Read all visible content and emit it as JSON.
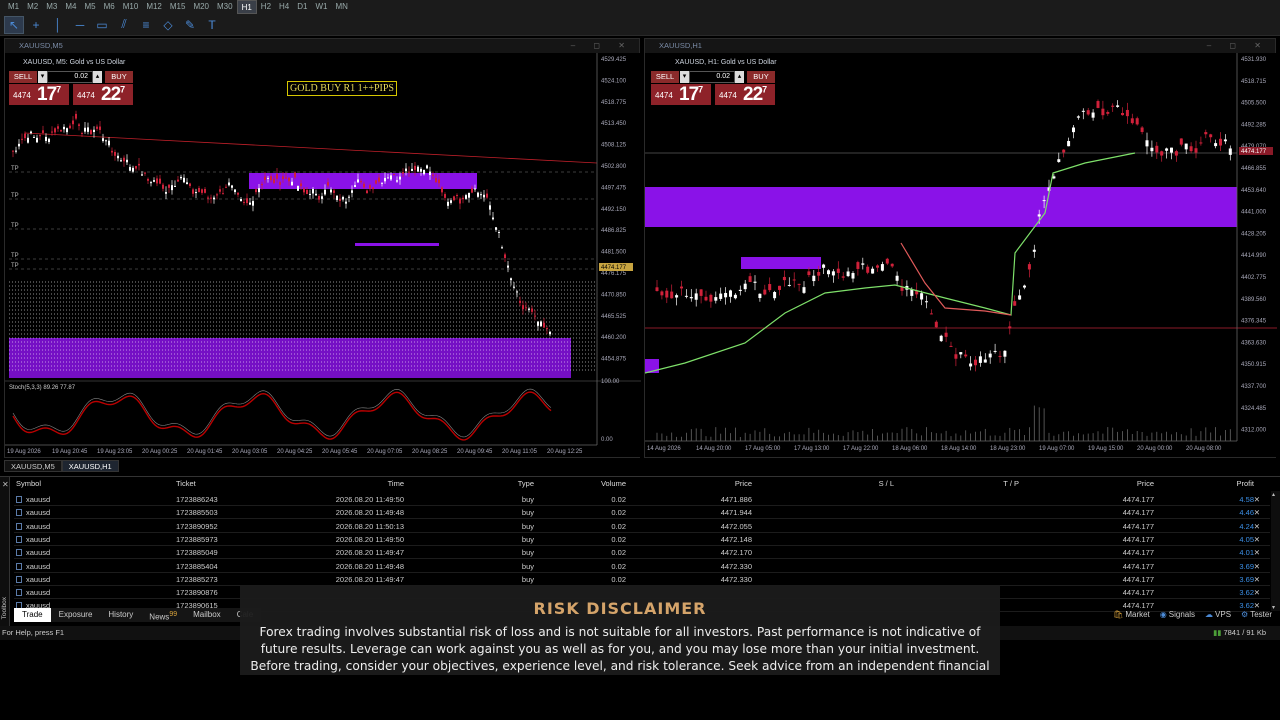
{
  "timeframes": [
    "M1",
    "M2",
    "M3",
    "M4",
    "M5",
    "M6",
    "M10",
    "M12",
    "M15",
    "M20",
    "M30",
    "H1",
    "H2",
    "H4",
    "D1",
    "W1",
    "MN"
  ],
  "active_timeframe": "H1",
  "toolbar_icons": [
    "cursor-icon",
    "crosshair-icon",
    "vertical-line-icon",
    "horizontal-line-icon",
    "rectangle-icon",
    "channel-icon",
    "fibonacci-icon",
    "shapes-icon",
    "pencil-icon",
    "text-icon"
  ],
  "left_window": {
    "title": "XAUUSD,M5",
    "symbol_label": "XAUUSD, M5:  Gold vs US Dollar",
    "sell_label": "SELL",
    "buy_label": "BUY",
    "volume": "0.02",
    "bid_small": "4474",
    "bid_big": "17",
    "bid_sup": "7",
    "ask_small": "4474",
    "ask_big": "22",
    "ask_sup": "7",
    "annotation": "GOLD BUY R1 1++PIPS",
    "indicator_label": "Stoch(5,3,3) 89.26 77.87",
    "y_ticks": [
      "4529.425",
      "4524.100",
      "4518.775",
      "4513.450",
      "4508.125",
      "4502.800",
      "4497.475",
      "4492.150",
      "4486.825",
      "4481.500",
      "4476.175",
      "4470.850",
      "4465.525",
      "4460.200",
      "4454.875",
      "100.00",
      "0.00"
    ],
    "highlight_tick": "4474.177",
    "x_ticks": [
      "19 Aug 2026",
      "19 Aug 20:45",
      "19 Aug 23:05",
      "20 Aug 00:25",
      "20 Aug 01:45",
      "20 Aug 03:05",
      "20 Aug 04:25",
      "20 Aug 05:45",
      "20 Aug 07:05",
      "20 Aug 08:25",
      "20 Aug 09:45",
      "20 Aug 11:05",
      "20 Aug 12:25"
    ],
    "tp_labels": [
      "TP",
      "TP",
      "TP",
      "TP",
      "TP"
    ]
  },
  "right_window": {
    "title": "XAUUSD,H1",
    "symbol_label": "XAUUSD, H1:  Gold vs US Dollar",
    "sell_label": "SELL",
    "buy_label": "BUY",
    "volume": "0.02",
    "bid_small": "4474",
    "bid_big": "17",
    "bid_sup": "7",
    "ask_small": "4474",
    "ask_big": "22",
    "ask_sup": "7",
    "y_ticks": [
      "4531.930",
      "4518.715",
      "4505.500",
      "4492.285",
      "4479.070",
      "4466.855",
      "4453.640",
      "4441.000",
      "4428.205",
      "4414.990",
      "4402.775",
      "4389.560",
      "4376.345",
      "4363.630",
      "4350.915",
      "4337.700",
      "4324.485",
      "4312.000"
    ],
    "highlight_tick": "4474.177",
    "x_ticks": [
      "14 Aug 2026",
      "14 Aug 20:00",
      "17 Aug 05:00",
      "17 Aug 13:00",
      "17 Aug 22:00",
      "18 Aug 06:00",
      "18 Aug 14:00",
      "18 Aug 23:00",
      "19 Aug 07:00",
      "19 Aug 15:00",
      "20 Aug 00:00",
      "20 Aug 08:00"
    ]
  },
  "chart_tabs": [
    "XAUUSD,M5",
    "XAUUSD,H1"
  ],
  "active_chart_tab": "XAUUSD,H1",
  "terminal": {
    "columns": [
      "Symbol",
      "Ticket",
      "Time",
      "Type",
      "Volume",
      "Price",
      "S / L",
      "T / P",
      "Price",
      "Profit"
    ],
    "rows": [
      {
        "symbol": "xauusd",
        "ticket": "1723886243",
        "time": "2026.08.20 11:49:50",
        "type": "buy",
        "volume": "0.02",
        "price": "4471.886",
        "sl": "",
        "tp": "",
        "cur": "4474.177",
        "profit": "4.58"
      },
      {
        "symbol": "xauusd",
        "ticket": "1723885503",
        "time": "2026.08.20 11:49:48",
        "type": "buy",
        "volume": "0.02",
        "price": "4471.944",
        "sl": "",
        "tp": "",
        "cur": "4474.177",
        "profit": "4.46"
      },
      {
        "symbol": "xauusd",
        "ticket": "1723890952",
        "time": "2026.08.20 11:50:13",
        "type": "buy",
        "volume": "0.02",
        "price": "4472.055",
        "sl": "",
        "tp": "",
        "cur": "4474.177",
        "profit": "4.24"
      },
      {
        "symbol": "xauusd",
        "ticket": "1723885973",
        "time": "2026.08.20 11:49:50",
        "type": "buy",
        "volume": "0.02",
        "price": "4472.148",
        "sl": "",
        "tp": "",
        "cur": "4474.177",
        "profit": "4.05"
      },
      {
        "symbol": "xauusd",
        "ticket": "1723885049",
        "time": "2026.08.20 11:49:47",
        "type": "buy",
        "volume": "0.02",
        "price": "4472.170",
        "sl": "",
        "tp": "",
        "cur": "4474.177",
        "profit": "4.01"
      },
      {
        "symbol": "xauusd",
        "ticket": "1723885404",
        "time": "2026.08.20 11:49:48",
        "type": "buy",
        "volume": "0.02",
        "price": "4472.330",
        "sl": "",
        "tp": "",
        "cur": "4474.177",
        "profit": "3.69"
      },
      {
        "symbol": "xauusd",
        "ticket": "1723885273",
        "time": "2026.08.20 11:49:47",
        "type": "buy",
        "volume": "0.02",
        "price": "4472.330",
        "sl": "",
        "tp": "",
        "cur": "4474.177",
        "profit": "3.69"
      },
      {
        "symbol": "xauusd",
        "ticket": "1723890876",
        "time": "",
        "type": "",
        "volume": "",
        "price": "",
        "sl": "",
        "tp": "",
        "cur": "4474.177",
        "profit": "3.62"
      },
      {
        "symbol": "xauusd",
        "ticket": "1723890615",
        "time": "",
        "type": "",
        "volume": "",
        "price": "",
        "sl": "",
        "tp": "",
        "cur": "4474.177",
        "profit": "3.62"
      }
    ],
    "side_label": "Toolbox"
  },
  "bottom_tabs": [
    "Trade",
    "Exposure",
    "History",
    "News",
    "Mailbox",
    "Cale"
  ],
  "news_badge": "99",
  "active_bottom_tab": "Trade",
  "right_tabs": [
    "Market",
    "Signals",
    "VPS",
    "Tester"
  ],
  "status_left": "For Help, press F1",
  "status_right": "7841 / 91 Kb",
  "disclaimer": {
    "title": "RISK DISCLAIMER",
    "text": "Forex trading involves substantial risk of loss and is not suitable for all investors. Past performance is not indicative of future results. Leverage can work against you as well as for you, and you may lose more than your initial investment. Before trading, consider your objectives, experience level, and risk tolerance. Seek advice from an independent financial"
  },
  "colors": {
    "bull": "#ffffff",
    "bear": "#d0213a",
    "zone": "#8a12e8",
    "ma_up": "#7ee06a",
    "ma_down": "#e05a5a",
    "stoch": "#c8203a"
  }
}
